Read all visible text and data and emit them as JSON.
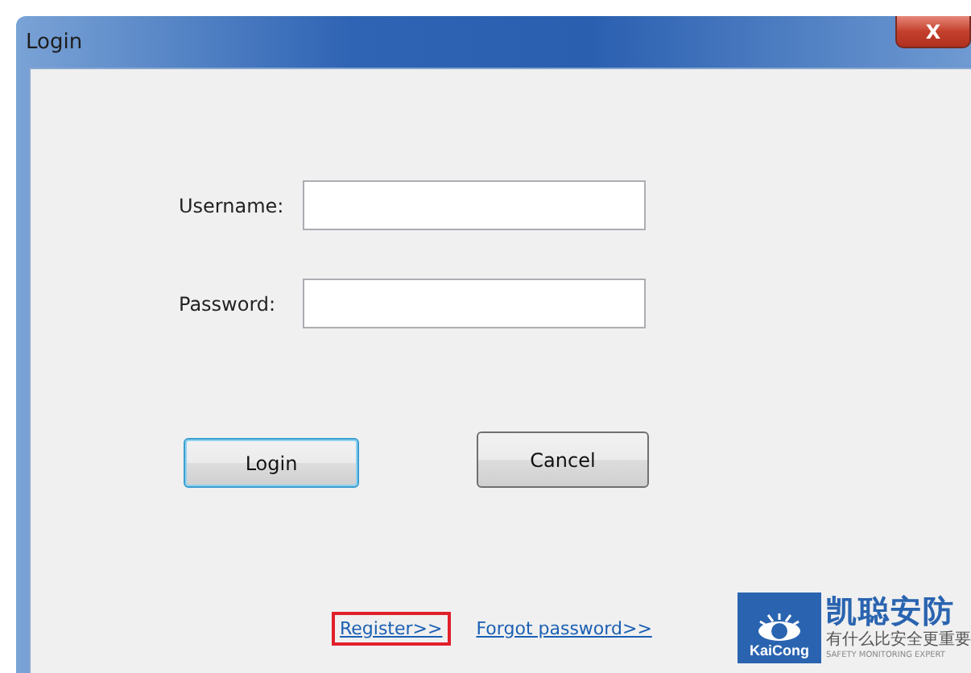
{
  "window": {
    "title": "Login",
    "close_label": "X"
  },
  "fields": [
    {
      "label": "Username:"
    },
    {
      "label": "Password:"
    }
  ],
  "buttons": [
    {
      "label": "Login",
      "default": true
    },
    {
      "label": "Cancel",
      "default": false
    }
  ],
  "links": [
    {
      "label": "Register>>",
      "highlighted": true
    },
    {
      "label": "Forgot password>>",
      "highlighted": false
    }
  ],
  "logo": {
    "emblem_text": "KaiCong",
    "name": "凯聪安防",
    "slogan": "有什么比安全更重要",
    "tagline": "SAFETY MONITORING EXPERT"
  }
}
